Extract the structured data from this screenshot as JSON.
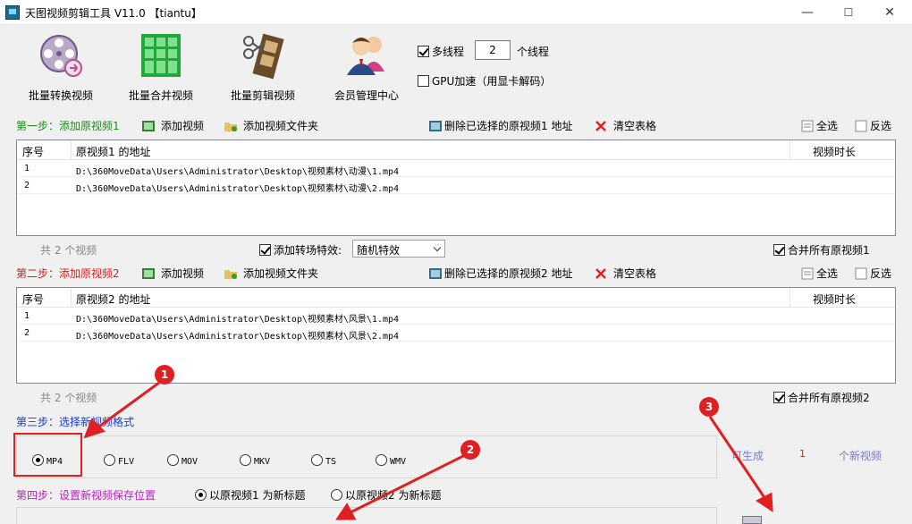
{
  "window": {
    "title": "天图视频剪辑工具 V11.0  【tiantu】",
    "min": "—",
    "max": "☐",
    "close": "✕"
  },
  "toolbar": {
    "items": [
      {
        "label": "批量转换视频",
        "icon": "film-reel-icon"
      },
      {
        "label": "批量合并视频",
        "icon": "grid-merge-icon"
      },
      {
        "label": "批量剪辑视频",
        "icon": "film-strip-scissors-icon"
      },
      {
        "label": "会员管理中心",
        "icon": "members-icon"
      }
    ],
    "multithread_label": "多线程",
    "thread_count": "2",
    "thread_suffix": "个线程",
    "gpu_label": "GPU加速（用显卡解码）"
  },
  "step1": {
    "title": "第一步：添加原视频1",
    "color": "#1a8a1a",
    "add_video": "添加视频",
    "add_folder": "添加视频文件夹",
    "delete_selected": "删除已选择的原视频1 地址",
    "clear_table": "清空表格",
    "select_all": "全选",
    "invert": "反选",
    "columns": [
      "序号",
      "原视频1 的地址",
      "视频时长"
    ],
    "rows": [
      {
        "index": "1",
        "path": "D:\\360MoveData\\Users\\Administrator\\Desktop\\视频素材\\动漫\\1.mp4"
      },
      {
        "index": "2",
        "path": "D:\\360MoveData\\Users\\Administrator\\Desktop\\视频素材\\动漫\\2.mp4"
      }
    ],
    "count": "共 2 个视频",
    "transition_label": "添加转场特效:",
    "transition_value": "随机特效",
    "merge_label": "合并所有原视频1"
  },
  "step2": {
    "title": "第二步：添加原视频2",
    "color": "#d42020",
    "add_video": "添加视频",
    "add_folder": "添加视频文件夹",
    "delete_selected": "删除已选择的原视频2 地址",
    "clear_table": "清空表格",
    "select_all": "全选",
    "invert": "反选",
    "columns": [
      "序号",
      "原视频2 的地址",
      "视频时长"
    ],
    "rows": [
      {
        "index": "1",
        "path": "D:\\360MoveData\\Users\\Administrator\\Desktop\\视频素材\\风景\\1.mp4"
      },
      {
        "index": "2",
        "path": "D:\\360MoveData\\Users\\Administrator\\Desktop\\视频素材\\风景\\2.mp4"
      }
    ],
    "count": "共 2 个视频",
    "merge_label": "合并所有原视频2"
  },
  "step3": {
    "title": "第三步：选择新视频格式",
    "color": "#1a3ad4",
    "formats": [
      "MP4",
      "FLV",
      "MOV",
      "MKV",
      "TS",
      "WMV"
    ],
    "selected": "MP4",
    "can_generate": "可生成",
    "generate_count": "1",
    "new_videos": "个新视频"
  },
  "step4": {
    "title": "第四步：设置新视频保存位置",
    "color": "#c020c0",
    "option1": "以原视频1 为新标题",
    "option2": "以原视频2 为新标题"
  },
  "annotations": {
    "b1": "1",
    "b2": "2",
    "b3": "3",
    "color": "#e02020"
  }
}
